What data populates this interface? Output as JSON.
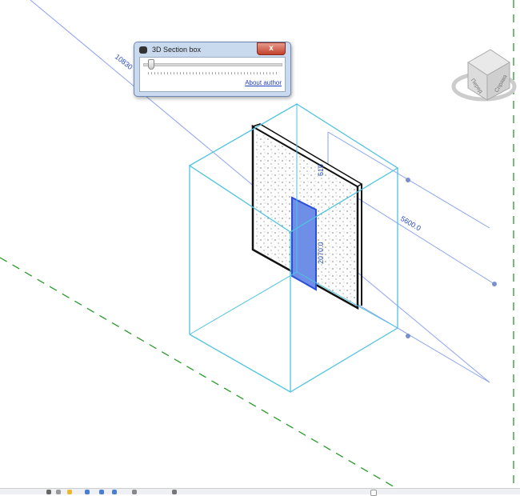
{
  "dialog": {
    "title": "3D Section box",
    "close_label": "x",
    "slider_value_fraction": 0.04,
    "about_link": "About author"
  },
  "viewcube": {
    "front_label": "Перед",
    "right_label": "Справа"
  },
  "dimensions": {
    "length": "10830",
    "width": "5600.0",
    "door_height": "2070.0",
    "small": "610"
  },
  "colors": {
    "section_box": "#4ec3e0",
    "annotation": "#5a7fe0",
    "door": "#5b7fe6",
    "grid_dashed": "#2a9a2a"
  }
}
